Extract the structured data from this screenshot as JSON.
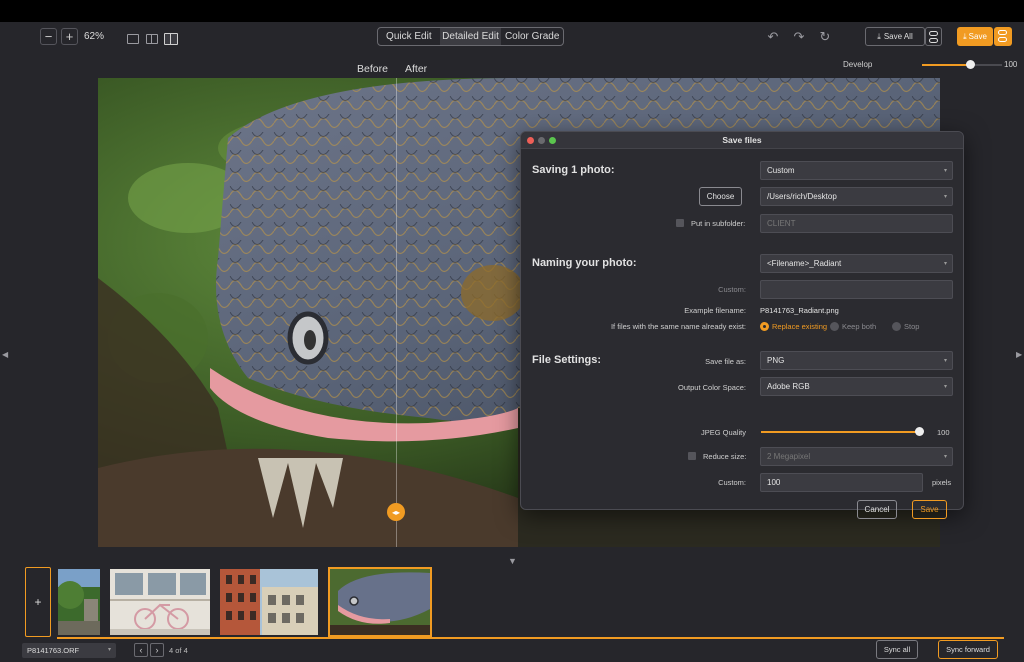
{
  "toolbar": {
    "zoom_out": "−",
    "zoom_in": "+",
    "zoom_level": "62%",
    "modes": [
      "Quick Edit",
      "Detailed Edit",
      "Color Grade"
    ],
    "active_mode": "Detailed Edit",
    "save_all_label": "Save All",
    "save_label": "Save",
    "accent_color": "#f19b22"
  },
  "compare": {
    "before": "Before",
    "after": "After"
  },
  "develop": {
    "label": "Develop",
    "value": "100",
    "fraction": 0.6
  },
  "dialog": {
    "title": "Save files",
    "saving_title": "Saving 1 photo:",
    "destination": "Custom",
    "choose_button": "Choose",
    "path": "/Users/rich/Desktop",
    "subfolder_label": "Put in subfolder:",
    "subfolder_placeholder": "CLIENT",
    "naming_title": "Naming your photo:",
    "naming_pattern": "<Filename>_Radiant",
    "custom_label": "Custom:",
    "custom_value": "",
    "example_label": "Example filename:",
    "example_value": "P8141763_Radiant.png",
    "conflict_label": "If files with the same name already exist:",
    "conflict_options": [
      "Replace existing",
      "Keep both",
      "Stop"
    ],
    "conflict_selected": "Replace existing",
    "file_settings_title": "File Settings:",
    "save_as_label": "Save file as:",
    "save_as_value": "PNG",
    "color_space_label": "Output Color Space:",
    "color_space_value": "Adobe RGB",
    "jpeg_quality_label": "JPEG Quality",
    "jpeg_quality_value": "100",
    "reduce_size_label": "Reduce size:",
    "reduce_size_value": "2 Megapixel",
    "custom_size_label": "Custom:",
    "custom_size_value": "100",
    "pixels_unit": "pixels",
    "cancel_button": "Cancel",
    "save_button": "Save"
  },
  "filmstrip": {
    "add_label": "+",
    "thumbnails": [
      "park-scene",
      "bicycle-storefront",
      "city-buildings",
      "iguana"
    ],
    "selected_index": 3
  },
  "bottom": {
    "filename": "P8141763.ORF",
    "prev": "‹",
    "next": "›",
    "counter": "4 of 4",
    "sync_all": "Sync all",
    "sync_forward": "Sync forward"
  }
}
